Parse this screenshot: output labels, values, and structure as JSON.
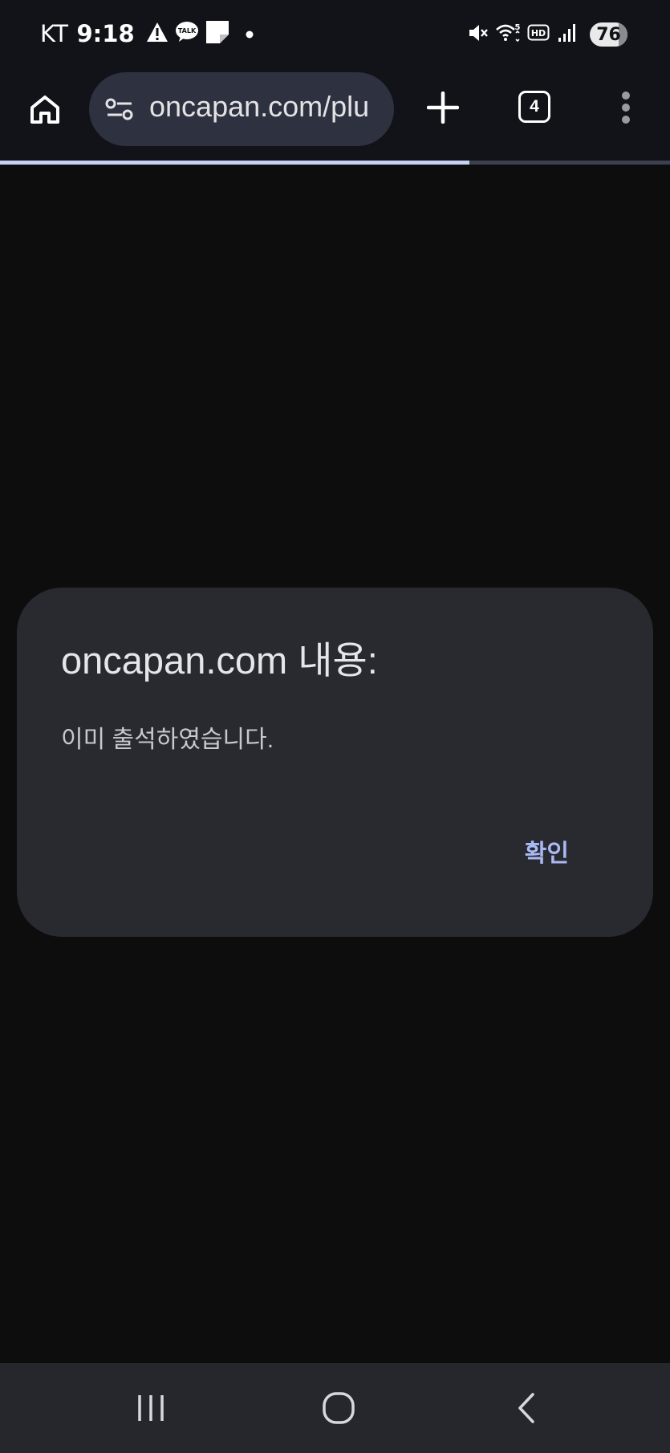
{
  "status_bar": {
    "carrier": "KT",
    "time": "9:18",
    "notification_icons": [
      "warning-icon",
      "kakaotalk-icon",
      "note-icon",
      "dot-icon"
    ],
    "system_icons": [
      "mute-icon",
      "wifi-icon",
      "hd-icon",
      "signal-icon"
    ],
    "battery": "76",
    "wifi_label": "5",
    "hd_label": "HD",
    "kakao_label": "TALK"
  },
  "toolbar": {
    "url": "oncapan.com/plu",
    "tab_count": "4",
    "load_progress": 0.7
  },
  "dialog": {
    "title": "oncapan.com 내용:",
    "message": "이미 출석하였습니다.",
    "ok_label": "확인",
    "accent_color": "#aab9f2"
  },
  "nav_bar": {
    "buttons": [
      "recents-icon",
      "home-icon",
      "back-icon"
    ]
  }
}
